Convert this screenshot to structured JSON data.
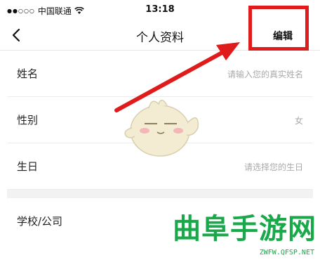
{
  "status_bar": {
    "carrier": "中国联通",
    "time": "13:18"
  },
  "nav": {
    "title": "个人资料",
    "edit_label": "编辑",
    "back_icon": "chevron-left-icon"
  },
  "form": {
    "rows": [
      {
        "label": "姓名",
        "value": "请输入您的真实姓名"
      },
      {
        "label": "性别",
        "value": "女"
      },
      {
        "label": "生日",
        "value": "请选择您的生日"
      },
      {
        "label": "学校/公司",
        "value": ""
      }
    ]
  },
  "annotation": {
    "color": "#e01b1b"
  },
  "watermark": {
    "title": "曲阜手游网",
    "url": "ZWFW.QFSP.NET",
    "color": "#19a94a"
  }
}
